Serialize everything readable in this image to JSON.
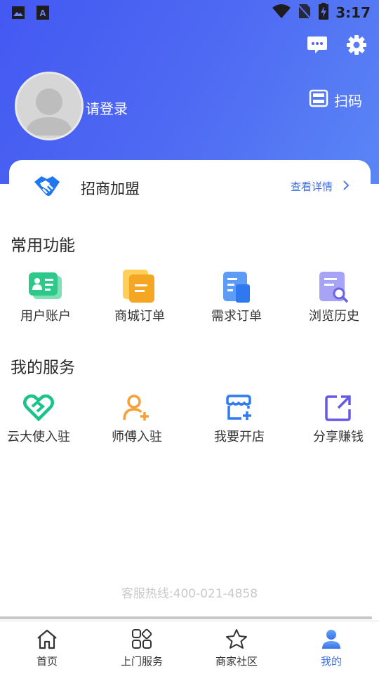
{
  "status_bar": {
    "time": "3:17",
    "left_icons": [
      "gallery-icon",
      "keyboard-a-icon"
    ],
    "right_icons": [
      "wifi-icon",
      "no-sim-icon",
      "battery-charging-icon"
    ]
  },
  "header": {
    "login_text": "请登录",
    "scan_label": "扫码",
    "message_icon": "message-icon",
    "settings_icon": "gear-icon"
  },
  "promo_card": {
    "title": "招商加盟",
    "link_text": "查看详情"
  },
  "common_functions": {
    "title": "常用功能",
    "items": [
      {
        "label": "用户账户",
        "icon": "user-account-icon"
      },
      {
        "label": "商城订单",
        "icon": "mall-order-icon"
      },
      {
        "label": "需求订单",
        "icon": "demand-order-icon"
      },
      {
        "label": "浏览历史",
        "icon": "browse-history-icon"
      }
    ]
  },
  "my_services": {
    "title": "我的服务",
    "items": [
      {
        "label": "云大使入驻",
        "icon": "ambassador-icon"
      },
      {
        "label": "师傅入驻",
        "icon": "master-join-icon"
      },
      {
        "label": "我要开店",
        "icon": "open-store-icon"
      },
      {
        "label": "分享赚钱",
        "icon": "share-icon"
      }
    ]
  },
  "hotline": "客服热线:400-021-4858",
  "tabbar": {
    "tabs": [
      {
        "label": "首页",
        "icon": "home-icon"
      },
      {
        "label": "上门服务",
        "icon": "services-grid-icon"
      },
      {
        "label": "商家社区",
        "icon": "star-icon"
      },
      {
        "label": "我的",
        "icon": "profile-icon"
      }
    ],
    "active_index": 3
  },
  "colors": {
    "header_start": "#4458f2",
    "header_end": "#5b86f6",
    "accent": "#3c6ee8"
  }
}
